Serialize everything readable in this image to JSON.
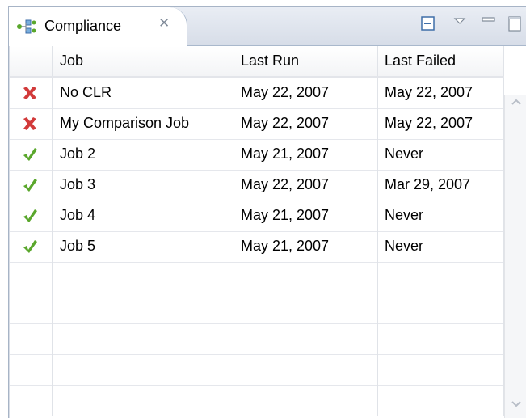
{
  "view": {
    "tab_title": "Compliance",
    "tab_icon": "compliance-icon",
    "close_icon": "close-icon",
    "toolbar_icons": [
      "collapse-icon",
      "view-menu-icon",
      "minimize-icon",
      "maximize-icon"
    ]
  },
  "table": {
    "columns": [
      "Job",
      "Last Run",
      "Last Failed"
    ],
    "rows": [
      {
        "status": "failed",
        "job": "No CLR",
        "last_run": "May 22, 2007",
        "last_failed": "May 22, 2007"
      },
      {
        "status": "failed",
        "job": "My Comparison Job",
        "last_run": "May 22, 2007",
        "last_failed": "May 22, 2007"
      },
      {
        "status": "passed",
        "job": "Job 2",
        "last_run": "May 21, 2007",
        "last_failed": "Never"
      },
      {
        "status": "passed",
        "job": "Job 3",
        "last_run": "May 22, 2007",
        "last_failed": "Mar 29, 2007"
      },
      {
        "status": "passed",
        "job": "Job 4",
        "last_run": "May 21, 2007",
        "last_failed": "Never"
      },
      {
        "status": "passed",
        "job": "Job 5",
        "last_run": "May 21, 2007",
        "last_failed": "Never"
      }
    ],
    "empty_rows": 5
  },
  "colors": {
    "failed": "#d23a3a",
    "passed": "#5aa72c",
    "tab_border": "#a9b8cc"
  }
}
